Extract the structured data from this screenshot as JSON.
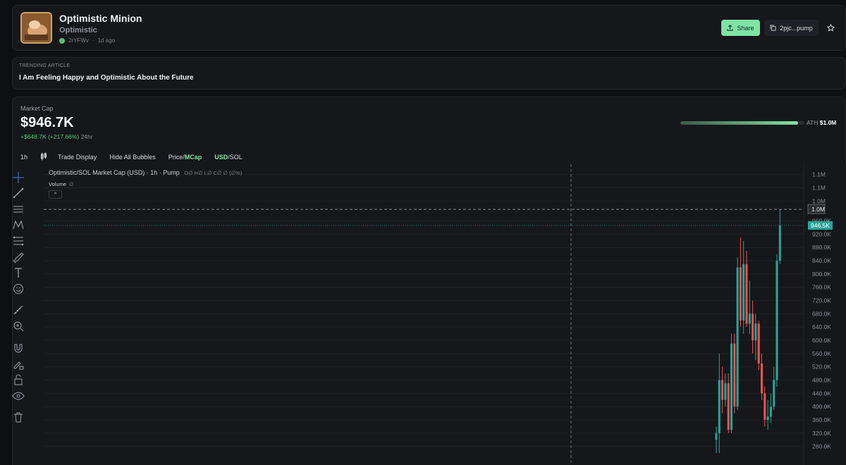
{
  "coin": {
    "name": "Optimistic Minion",
    "ticker": "Optimistic",
    "creator": "2rYFWv",
    "separator": "·",
    "age": "1d ago"
  },
  "actions": {
    "share_label": "Share",
    "address_label": "2pjc...pump",
    "share_icon": "upload-icon",
    "copy_icon": "copy-icon",
    "favorite_icon": "star-icon"
  },
  "article": {
    "label": "TRENDING ARTICLE",
    "title": "I Am Feeling Happy and Optimistic About the Future"
  },
  "market": {
    "label": "Market Cap",
    "value": "$946.7K",
    "change": "+$648.7K (+217.66%)",
    "period": "24hr",
    "ath_label": "ATH",
    "ath_value": "$1.0M",
    "ath_progress": 0.947
  },
  "toolbar": {
    "interval": "1h",
    "candle_icon": "candlestick-icon",
    "trade_display": "Trade Display",
    "hide_bubbles": "Hide All Bubbles",
    "price_label": "Price/",
    "mcap_label": "MCap",
    "usd_label": "USD",
    "sol_label": "/SOL"
  },
  "tools": [
    "crosshair-icon",
    "trend-line-icon",
    "horizontal-lines-icon",
    "pattern-icon",
    "fib-icon",
    "brush-icon",
    "text-icon",
    "emoji-icon",
    "ruler-icon",
    "zoom-in-icon",
    "magnet-icon",
    "lock-drawing-icon",
    "lock-icon",
    "eye-icon",
    "trash-icon"
  ],
  "chart": {
    "legend": "Optimistic/SOL Market Cap (USD) · 1h · Pump",
    "ohlc": "O∅ H∅ L∅ C∅ ∅ (∅%)",
    "volume_label": "Volume",
    "volume_value": "∅",
    "collapse_label": "^"
  },
  "chart_data": {
    "type": "candlestick",
    "y_ticks": [
      "1.1M",
      "1.1M",
      "1.0M",
      "960.0K",
      "920.0K",
      "880.0K",
      "840.0K",
      "800.0K",
      "760.0K",
      "720.0K",
      "680.0K",
      "640.0K",
      "600.0K",
      "560.0K",
      "520.0K",
      "480.0K",
      "440.0K",
      "400.0K",
      "360.0K",
      "320.0K",
      "280.0K"
    ],
    "y_tick_values": [
      1100000,
      1060000,
      1020000,
      960000,
      920000,
      880000,
      840000,
      800000,
      760000,
      720000,
      680000,
      640000,
      600000,
      560000,
      520000,
      480000,
      440000,
      400000,
      360000,
      320000,
      280000
    ],
    "ylim": [
      260000,
      1110000
    ],
    "ath_marker": {
      "label": "1.0M",
      "value": 995000
    },
    "current_marker": {
      "label": "946.5K",
      "value": 946500
    },
    "colors": {
      "up": "#26a69a",
      "down": "#ef5350",
      "current": "#26a69a"
    },
    "candles": [
      {
        "o": 300000,
        "h": 340000,
        "l": 260000,
        "c": 320000
      },
      {
        "o": 320000,
        "h": 560000,
        "l": 260000,
        "c": 480000
      },
      {
        "o": 480000,
        "h": 520000,
        "l": 380000,
        "c": 420000
      },
      {
        "o": 420000,
        "h": 500000,
        "l": 400000,
        "c": 470000
      },
      {
        "o": 470000,
        "h": 500000,
        "l": 320000,
        "c": 330000
      },
      {
        "o": 330000,
        "h": 620000,
        "l": 320000,
        "c": 590000
      },
      {
        "o": 590000,
        "h": 620000,
        "l": 380000,
        "c": 400000
      },
      {
        "o": 400000,
        "h": 850000,
        "l": 390000,
        "c": 820000
      },
      {
        "o": 820000,
        "h": 910000,
        "l": 640000,
        "c": 660000
      },
      {
        "o": 660000,
        "h": 900000,
        "l": 620000,
        "c": 830000
      },
      {
        "o": 830000,
        "h": 870000,
        "l": 640000,
        "c": 650000
      },
      {
        "o": 650000,
        "h": 780000,
        "l": 620000,
        "c": 680000
      },
      {
        "o": 680000,
        "h": 720000,
        "l": 560000,
        "c": 600000
      },
      {
        "o": 600000,
        "h": 680000,
        "l": 540000,
        "c": 650000
      },
      {
        "o": 650000,
        "h": 660000,
        "l": 510000,
        "c": 530000
      },
      {
        "o": 530000,
        "h": 560000,
        "l": 420000,
        "c": 440000
      },
      {
        "o": 440000,
        "h": 460000,
        "l": 340000,
        "c": 360000
      },
      {
        "o": 360000,
        "h": 420000,
        "l": 330000,
        "c": 370000
      },
      {
        "o": 370000,
        "h": 440000,
        "l": 350000,
        "c": 400000
      },
      {
        "o": 400000,
        "h": 520000,
        "l": 390000,
        "c": 480000
      },
      {
        "o": 480000,
        "h": 860000,
        "l": 460000,
        "c": 840000
      },
      {
        "o": 840000,
        "h": 995000,
        "l": 830000,
        "c": 946500
      }
    ]
  }
}
